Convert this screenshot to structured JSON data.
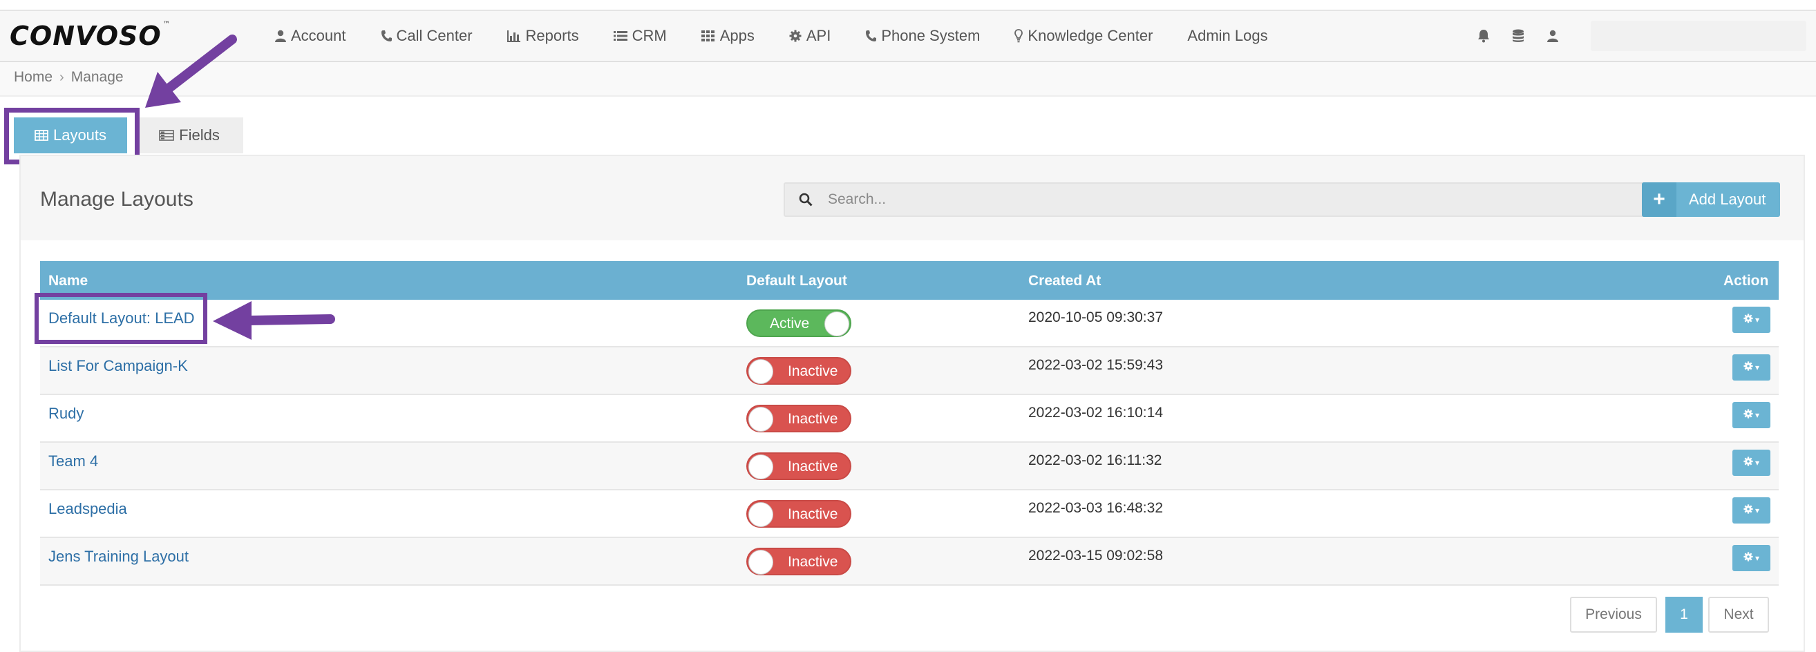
{
  "brand": {
    "name": "CONVOSO",
    "trademark": "™"
  },
  "nav": {
    "items": [
      {
        "label": "Account",
        "icon": "user-icon"
      },
      {
        "label": "Call Center",
        "icon": "phone-icon"
      },
      {
        "label": "Reports",
        "icon": "bar-chart-icon"
      },
      {
        "label": "CRM",
        "icon": "list-icon"
      },
      {
        "label": "Apps",
        "icon": "grid-icon"
      },
      {
        "label": "API",
        "icon": "gear-icon"
      },
      {
        "label": "Phone System",
        "icon": "phone-icon"
      },
      {
        "label": "Knowledge Center",
        "icon": "lightbulb-icon"
      },
      {
        "label": "Admin Logs",
        "icon": ""
      }
    ],
    "right_icons": [
      "bell-icon",
      "database-icon",
      "user-icon"
    ]
  },
  "breadcrumb": {
    "home": "Home",
    "separator": "›",
    "current": "Manage"
  },
  "tabs": [
    {
      "label": "Layouts",
      "icon": "table-icon",
      "active": true
    },
    {
      "label": "Fields",
      "icon": "fields-icon",
      "active": false
    }
  ],
  "panel": {
    "title": "Manage Layouts",
    "search_placeholder": "Search...",
    "add_button": "Add Layout"
  },
  "table": {
    "columns": [
      "Name",
      "Default Layout",
      "Created At",
      "Action"
    ],
    "rows": [
      {
        "name": "Default Layout: LEAD",
        "status": "Active",
        "created_at": "2020-10-05 09:30:37"
      },
      {
        "name": "List For Campaign-K",
        "status": "Inactive",
        "created_at": "2022-03-02 15:59:43"
      },
      {
        "name": "Rudy",
        "status": "Inactive",
        "created_at": "2022-03-02 16:10:14"
      },
      {
        "name": "Team 4",
        "status": "Inactive",
        "created_at": "2022-03-02 16:11:32"
      },
      {
        "name": "Leadspedia",
        "status": "Inactive",
        "created_at": "2022-03-03 16:48:32"
      },
      {
        "name": "Jens Training Layout",
        "status": "Inactive",
        "created_at": "2022-03-15 09:02:58"
      }
    ]
  },
  "pagination": {
    "previous": "Previous",
    "current": "1",
    "next": "Next"
  },
  "colors": {
    "accent": "#6bb4d3",
    "active": "#5cb85c",
    "inactive": "#d9534f",
    "annotation": "#7340a0",
    "link": "#2d6fa6"
  }
}
